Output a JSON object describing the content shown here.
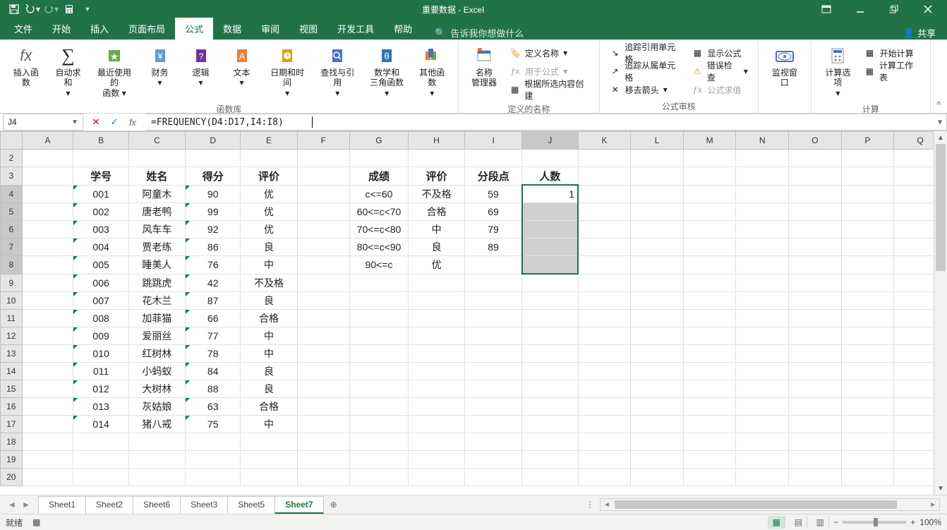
{
  "title": "重要数据 - Excel",
  "qat_icons": [
    "save-icon",
    "undo-icon",
    "redo-icon",
    "calc-icon",
    "customize-icon"
  ],
  "win": [
    "ribbon-opts-icon",
    "minimize-icon",
    "restore-icon",
    "close-icon"
  ],
  "tabs": {
    "file": "文件",
    "home": "开始",
    "insert": "插入",
    "page": "页面布局",
    "formulas": "公式",
    "data": "数据",
    "review": "审阅",
    "view": "视图",
    "dev": "开发工具",
    "help": "帮助"
  },
  "tell_me": "告诉我你想做什么",
  "share": "共享",
  "ribbon": {
    "insert_fn": "插入函数",
    "autosum": "自动求和",
    "recent": "最近使用的\n函数",
    "financial": "财务",
    "logical": "逻辑",
    "text": "文本",
    "datetime": "日期和时间",
    "lookup": "查找与引用",
    "math": "数学和\n三角函数",
    "more": "其他函数",
    "group_fnlib": "函数库",
    "name_mgr": "名称\n管理器",
    "def_name": "定义名称",
    "use_in": "用于公式",
    "from_sel": "根据所选内容创建",
    "group_names": "定义的名称",
    "trace_pre": "追踪引用单元格",
    "trace_dep": "追踪从属单元格",
    "remove_arrows": "移去箭头",
    "show_formulas": "显示公式",
    "err_check": "错误检查",
    "eval": "公式求值",
    "group_audit": "公式审核",
    "watch": "监视窗口",
    "calc_opts": "计算选项",
    "calc_now": "开始计算",
    "calc_sheet": "计算工作表",
    "group_calc": "计算"
  },
  "namebox": "J4",
  "formula": "=FREQUENCY(D4:D17,I4:I8)",
  "columns": [
    "A",
    "B",
    "C",
    "D",
    "E",
    "F",
    "G",
    "H",
    "I",
    "J",
    "K",
    "L",
    "M",
    "N",
    "O",
    "P",
    "Q"
  ],
  "rows": [
    2,
    3,
    4,
    5,
    6,
    7,
    8,
    9,
    10,
    11,
    12,
    13,
    14,
    15,
    16,
    17,
    18,
    19,
    20
  ],
  "header_row": {
    "B": "学号",
    "C": "姓名",
    "D": "得分",
    "E": "评价",
    "G": "成绩",
    "H": "评价",
    "I": "分段点",
    "J": "人数"
  },
  "data_rows": [
    {
      "r": 4,
      "B": "001",
      "C": "阿童木",
      "D": "90",
      "E": "优",
      "G": "c<=60",
      "H": "不及格",
      "I": "59",
      "J": "1"
    },
    {
      "r": 5,
      "B": "002",
      "C": "唐老鸭",
      "D": "99",
      "E": "优",
      "G": "60<=c<70",
      "H": "合格",
      "I": "69"
    },
    {
      "r": 6,
      "B": "003",
      "C": "风车车",
      "D": "92",
      "E": "优",
      "G": "70<=c<80",
      "H": "中",
      "I": "79"
    },
    {
      "r": 7,
      "B": "004",
      "C": "贾老练",
      "D": "86",
      "E": "良",
      "G": "80<=c<90",
      "H": "良",
      "I": "89"
    },
    {
      "r": 8,
      "B": "005",
      "C": "睡美人",
      "D": "76",
      "E": "中",
      "G": "90<=c",
      "H": "优"
    },
    {
      "r": 9,
      "B": "006",
      "C": "跳跳虎",
      "D": "42",
      "E": "不及格"
    },
    {
      "r": 10,
      "B": "007",
      "C": "花木兰",
      "D": "87",
      "E": "良"
    },
    {
      "r": 11,
      "B": "008",
      "C": "加菲猫",
      "D": "66",
      "E": "合格"
    },
    {
      "r": 12,
      "B": "009",
      "C": "爱丽丝",
      "D": "77",
      "E": "中"
    },
    {
      "r": 13,
      "B": "010",
      "C": "红树林",
      "D": "78",
      "E": "中"
    },
    {
      "r": 14,
      "B": "011",
      "C": "小蚂蚁",
      "D": "84",
      "E": "良"
    },
    {
      "r": 15,
      "B": "012",
      "C": "大树林",
      "D": "88",
      "E": "良"
    },
    {
      "r": 16,
      "B": "013",
      "C": "灰姑娘",
      "D": "63",
      "E": "合格"
    },
    {
      "r": 17,
      "B": "014",
      "C": "猪八戒",
      "D": "75",
      "E": "中"
    }
  ],
  "sheets": [
    "Sheet1",
    "Sheet2",
    "Sheet6",
    "Sheet3",
    "Sheet5",
    "Sheet7"
  ],
  "active_sheet": "Sheet7",
  "status": {
    "ready": "就绪",
    "zoom": "100%"
  }
}
